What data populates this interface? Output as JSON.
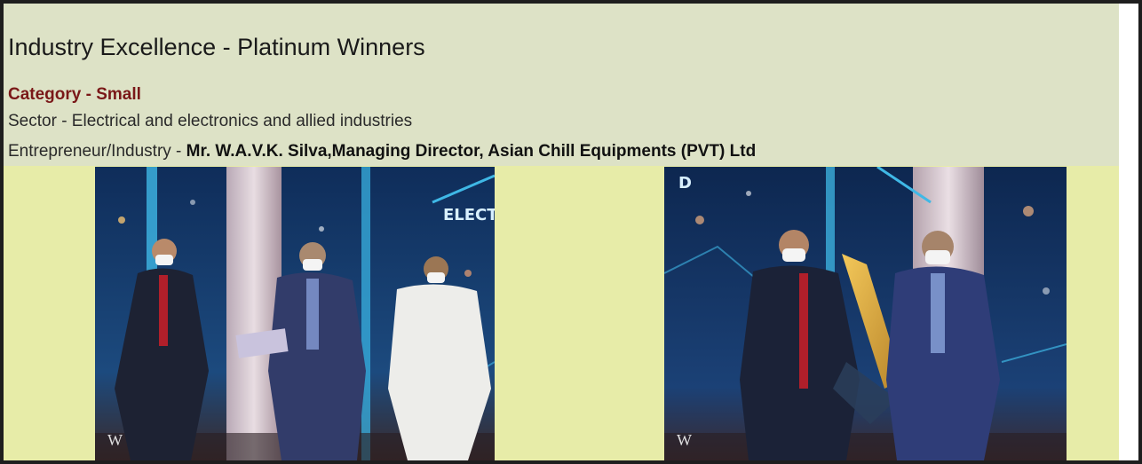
{
  "section": {
    "title": "Industry Excellence - Platinum Winners",
    "category": "Category - Small",
    "sector": "Sector - Electrical and electronics and allied industries",
    "entrepreneur_prefix": "Entrepreneur/Industry - ",
    "entrepreneur_name": "Mr. W.A.V.K. Silva,Managing Director, Asian Chill Equipments (PVT) Ltd"
  },
  "photos": [
    {
      "backdrop_text": "ELECT",
      "watermark": "W"
    },
    {
      "backdrop_text": "D",
      "watermark": "W"
    }
  ],
  "colors": {
    "panel_background": "#e7eca8",
    "header_background": "#dde2c6",
    "category_text": "#7a1818"
  }
}
